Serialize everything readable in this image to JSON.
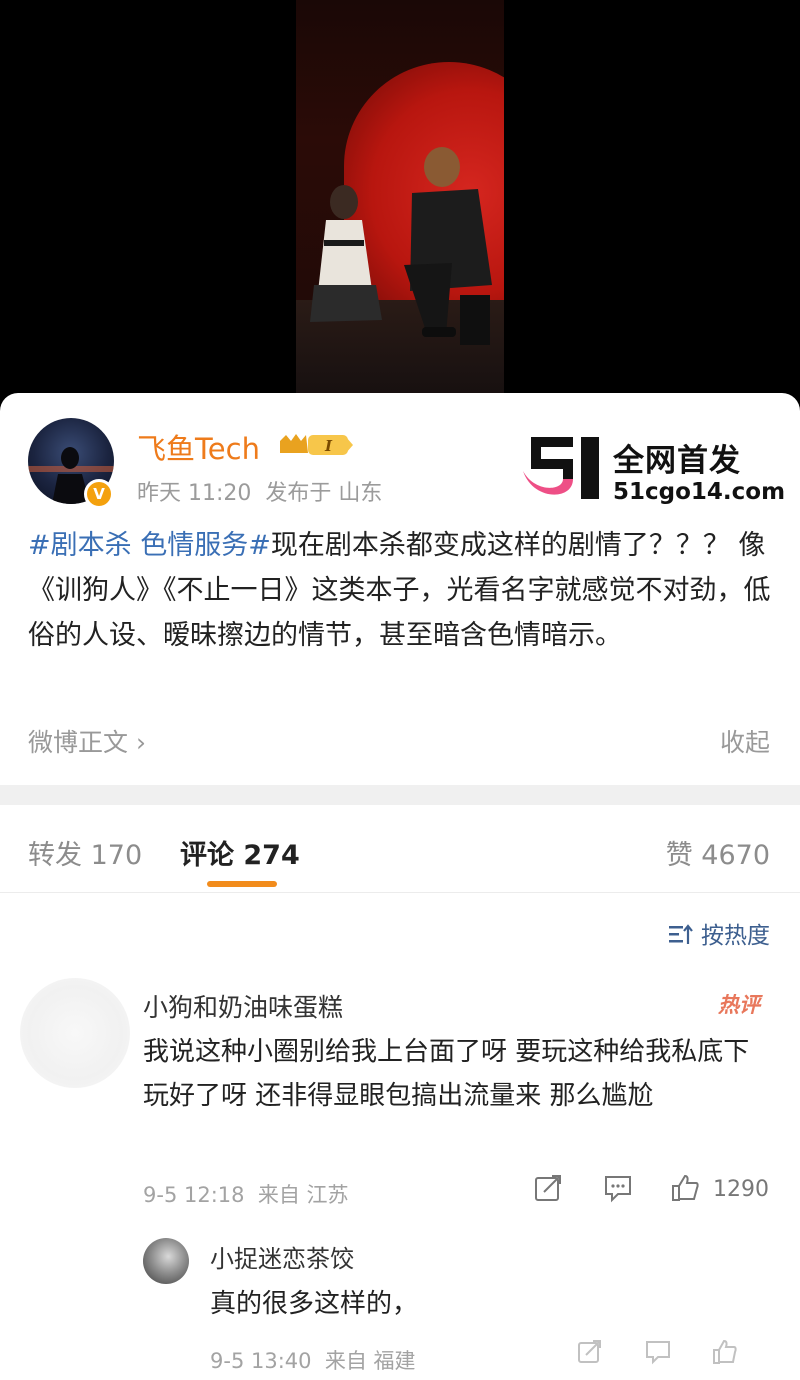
{
  "post": {
    "author": "飞鱼Tech",
    "vip_badge": "I",
    "verified_badge": "V",
    "time": "昨天 11:20",
    "location": "发布于 山东",
    "hashtag": "#剧本杀 色情服务#",
    "body": "现在剧本杀都变成这样的剧情了？？？ 像《训狗人》《不止一日》这类本子，光看名字就感觉不对劲，低俗的人设、暧昧擦边的情节，甚至暗含色情暗示。",
    "source_link": "微博正文 ›",
    "collapse_label": "收起"
  },
  "watermark": {
    "title": "全网首发",
    "url": "51cgo14.com"
  },
  "tabs": {
    "repost": "转发 170",
    "comment": "评论 274",
    "like": "赞 4670"
  },
  "sort_label": "按热度",
  "comments": [
    {
      "name": "小狗和奶油味蛋糕",
      "badge": "热评",
      "text": "我说这种小圈别给我上台面了呀 要玩这种给我私底下玩好了呀 还非得显眼包搞出流量来 那么尴尬",
      "time": "9-5 12:18",
      "location": "来自 江苏",
      "likes": "1290"
    }
  ],
  "reply": {
    "name": "小捉迷恋茶饺",
    "text": "真的很多这样的，",
    "time": "9-5 13:40",
    "location": "来自 福建"
  },
  "colors": {
    "accent": "#f28c1c",
    "username": "#ee7b1b",
    "link": "#3a6fb5"
  }
}
